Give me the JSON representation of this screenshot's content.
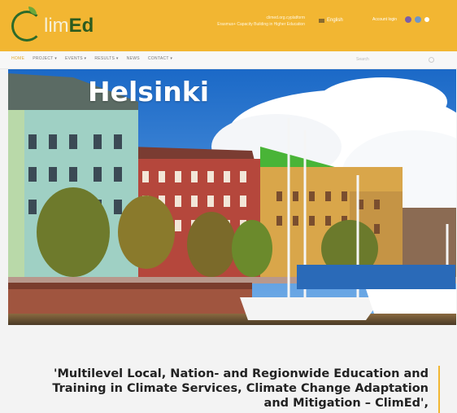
{
  "header": {
    "logo_prefix": "C",
    "logo_mid": "lim",
    "logo_suffix": "Ed",
    "info_line1": "climed.org.cyplatform",
    "info_line2": "Erasmus+ Capacity Building in Higher Education",
    "language": "English",
    "account": "Account login"
  },
  "nav": {
    "items": [
      "HOME",
      "PROJECT ▾",
      "EVENTS ▾",
      "RESULTS ▾",
      "NEWS",
      "CONTACT ▾"
    ],
    "search_placeholder": "Search"
  },
  "hero": {
    "title": "Helsinki"
  },
  "quote": {
    "line1": "'Multilevel Local, Nation- and Regionwide Education and",
    "line2": "Training in Climate Services, Climate Change Adaptation",
    "line3": "and Mitigation – ClimEd',"
  },
  "colors": {
    "accent": "#f2b632",
    "brand_green": "#2c5b1f"
  }
}
